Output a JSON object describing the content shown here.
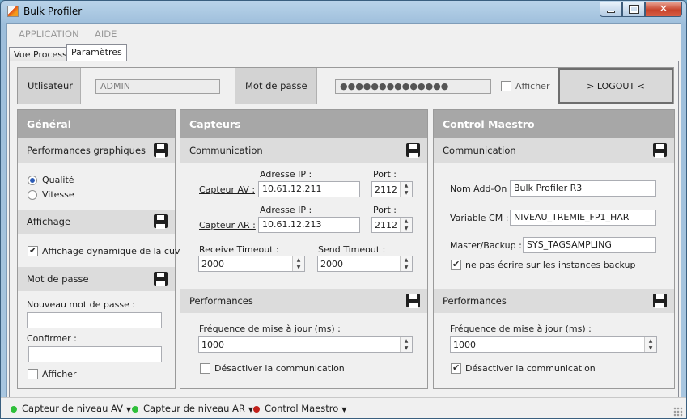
{
  "window": {
    "title": "Bulk Profiler"
  },
  "menu": [
    "APPLICATION",
    "AIDE"
  ],
  "tabs": [
    "Vue Process",
    "Paramètres"
  ],
  "user_bar": {
    "user_label": "Utlisateur",
    "user_value": "ADMIN",
    "password_label": "Mot de passe",
    "password_value": "●●●●●●●●●●●●●●",
    "show_label": "Afficher",
    "logout_label": "> LOGOUT <"
  },
  "general": {
    "title": "Général",
    "perf_title": "Performances graphiques",
    "quality": "Qualité",
    "speed": "Vitesse",
    "display_title": "Affichage",
    "dynamic_display": "Affichage dynamique de la cuve",
    "password_title": "Mot de passe",
    "new_password_label": "Nouveau mot de passe :",
    "confirm_label": "Confirmer :",
    "show_label": "Afficher"
  },
  "capteurs": {
    "title": "Capteurs",
    "comm_title": "Communication",
    "ip_label": "Adresse IP  :",
    "port_label": "Port  :",
    "av_label": "Capteur AV :",
    "av_ip": "10.61.12.211",
    "av_port": "2112",
    "ar_label": "Capteur AR :",
    "ar_ip": "10.61.12.213",
    "ar_port": "2112",
    "recv_label": "Receive Timeout  :",
    "recv_value": "2000",
    "send_label": "Send Timeout  :",
    "send_value": "2000",
    "perf_title": "Performances",
    "freq_label": "Fréquence de mise à jour (ms) :",
    "freq_value": "1000",
    "disable_label": "Désactiver la communication"
  },
  "maestro": {
    "title": "Control Maestro",
    "comm_title": "Communication",
    "addon_label": "Nom Add-On :",
    "addon_value": "Bulk Profiler R3",
    "cm_label": "Variable CM :",
    "cm_value": "NIVEAU_TREMIE_FP1_HAR",
    "mb_label": "Master/Backup :",
    "mb_value": "SYS_TAGSAMPLING",
    "no_backup_label": "ne pas écrire sur les instances backup",
    "perf_title": "Performances",
    "freq_label": "Fréquence de mise à jour (ms) :",
    "freq_value": "1000",
    "disable_label": "Désactiver la communication"
  },
  "status": [
    {
      "label": "Capteur de niveau AV",
      "color": "#2fbf3a"
    },
    {
      "label": "Capteur de niveau AR",
      "color": "#2fbf3a"
    },
    {
      "label": "Control Maestro",
      "color": "#c0201a"
    }
  ]
}
